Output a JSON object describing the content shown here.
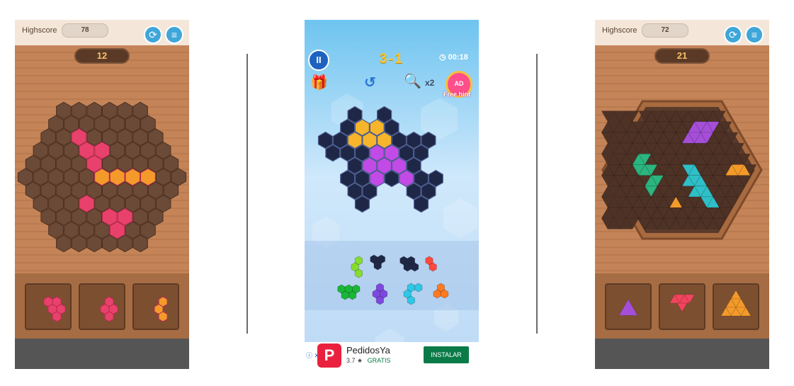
{
  "left_game": {
    "highscore_label": "Highscore",
    "highscore_value": "78",
    "score": "12",
    "restart_icon": "restart-icon",
    "menu_icon": "menu-icon"
  },
  "middle_game": {
    "level": "3-1",
    "timer": "00:18",
    "hint_multiplier": "x2",
    "free_hint_badge": "AD",
    "free_hint_label": "Free hint",
    "pause_icon": "pause-icon",
    "gift_icon": "gift-icon",
    "undo_icon": "undo-icon",
    "magnifier_icon": "magnifier-icon",
    "ad": {
      "app_name": "PedidosYa",
      "rating": "3.7 ★",
      "price": "GRATIS",
      "install_label": "INSTALAR",
      "logo_letter": "P",
      "info_icon": "ⓘ ✕"
    }
  },
  "right_game": {
    "highscore_label": "Highscore",
    "highscore_value": "72",
    "score": "21"
  },
  "colors": {
    "wood": "#c48458",
    "pink_piece": "#e8426c",
    "orange_piece": "#f39a2a",
    "purple_piece": "#a54fd9",
    "teal_piece": "#2fbfc7",
    "blue_button": "#3ea6d9"
  }
}
